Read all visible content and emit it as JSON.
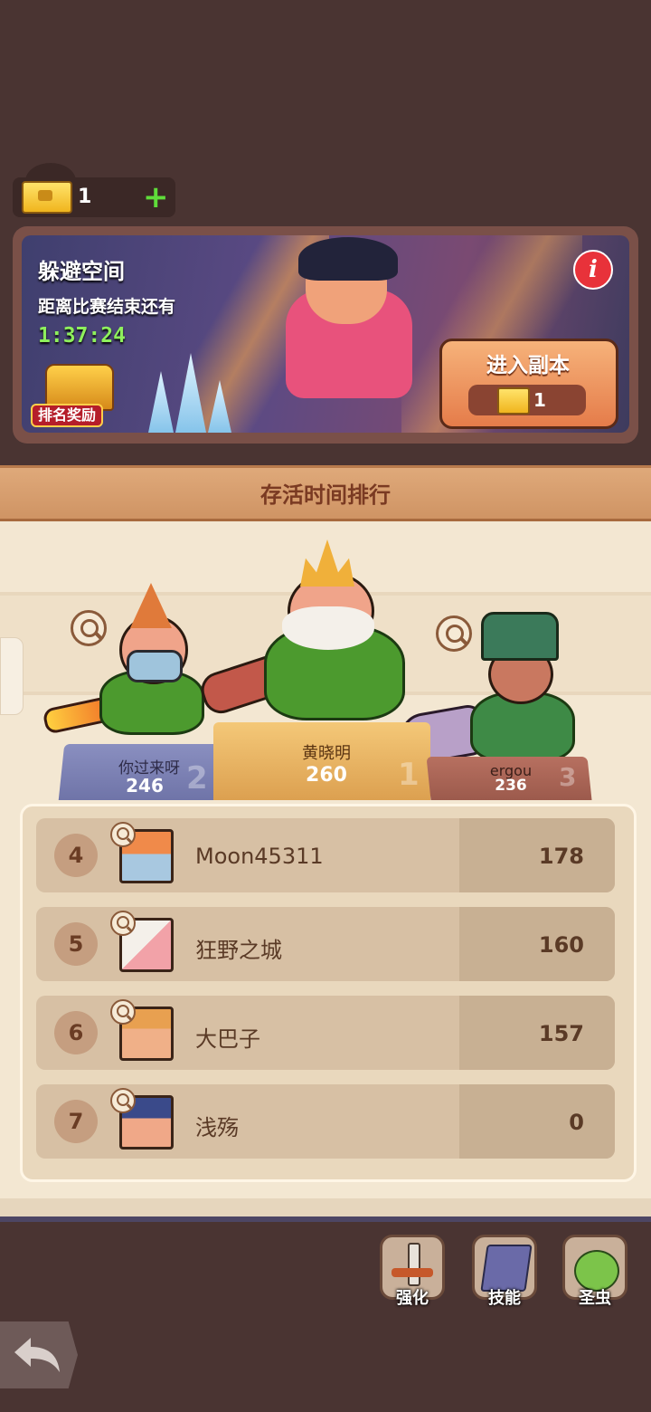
{
  "currency": {
    "tickets": "1",
    "add": "+"
  },
  "event": {
    "title": "躲避空间",
    "countdown_label": "距离比赛结束还有",
    "countdown": "1:37:24",
    "info_icon": "i",
    "ranking_reward_label": "排名奖励",
    "enter_button_label": "进入副本",
    "enter_cost": "1"
  },
  "leaderboard": {
    "title": "存活时间排行",
    "podium": [
      {
        "rank": "1",
        "name": "黄晓明",
        "score": "260"
      },
      {
        "rank": "2",
        "name": "你过来呀",
        "score": "246"
      },
      {
        "rank": "3",
        "name": "ergou",
        "score": "236"
      }
    ],
    "rows": [
      {
        "rank": "4",
        "name": "Moon45311",
        "score": "178"
      },
      {
        "rank": "5",
        "name": "狂野之城",
        "score": "160"
      },
      {
        "rank": "6",
        "name": "大巴子",
        "score": "157"
      },
      {
        "rank": "7",
        "name": "浅殇",
        "score": "0"
      }
    ]
  },
  "toolbar": {
    "upgrade_label": "强化",
    "skills_label": "技能",
    "beetle_label": "圣虫"
  },
  "icons": {
    "ticket": "ticket-icon",
    "info": "info-icon",
    "search": "magnifier-icon",
    "back": "back-arrow-icon"
  },
  "colors": {
    "background": "#4a3432",
    "timer": "#8ef05c",
    "accent_orange": "#e57c4a",
    "panel": "#f3e7d2"
  }
}
